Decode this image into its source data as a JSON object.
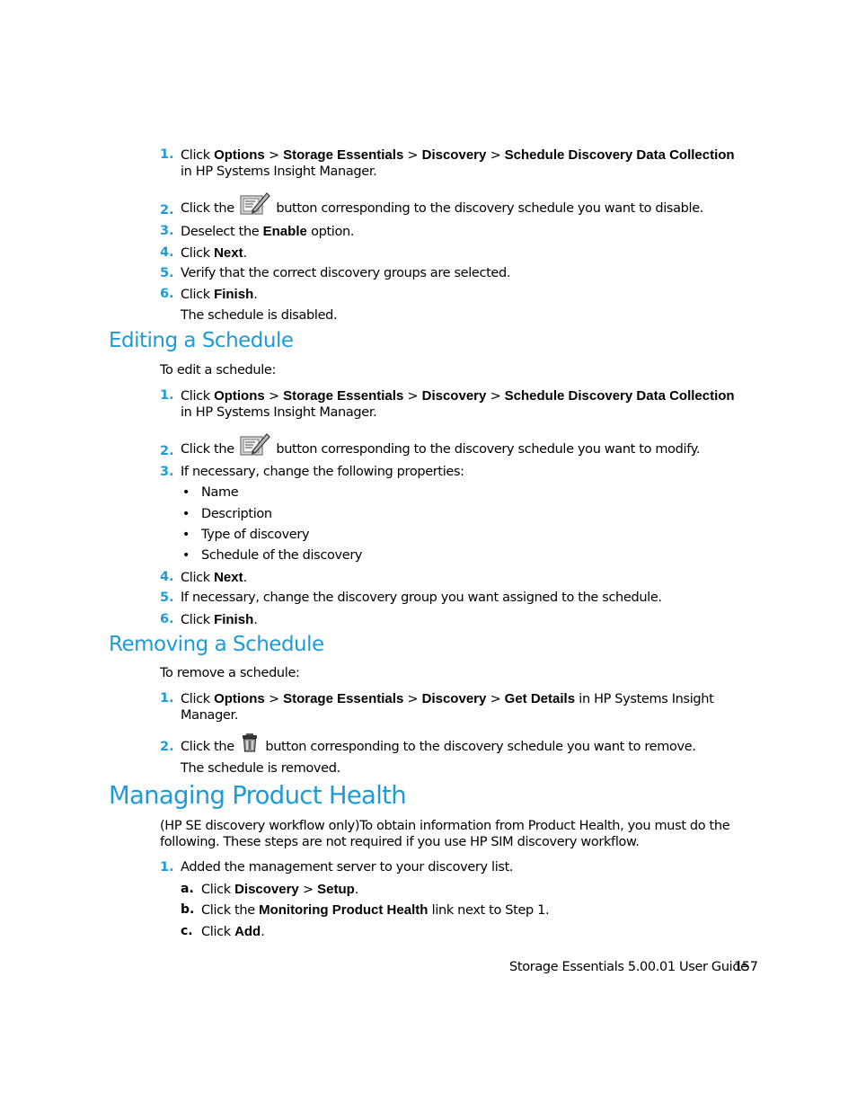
{
  "disable_steps": {
    "step1": {
      "num": "1.",
      "pre": "Click ",
      "b1": "Options",
      "sep1": " > ",
      "b2": "Storage Essentials",
      "sep2": " > ",
      "b3": "Discovery",
      "sep3": " > ",
      "b4": "Schedule Discovery Data Collection",
      "line2": "in HP Systems Insight Manager."
    },
    "step2": {
      "num": "2.",
      "pre": "Click the",
      "icon": "edit-schedule-icon",
      "post": "button corresponding to the discovery schedule you want to disable."
    },
    "step3": {
      "num": "3.",
      "pre": "Deselect the ",
      "b": "Enable",
      "post": " option."
    },
    "step4": {
      "num": "4.",
      "pre": "Click ",
      "b": "Next",
      "post": "."
    },
    "step5": {
      "num": "5.",
      "text": "Verify that the correct discovery groups are selected."
    },
    "step6": {
      "num": "6.",
      "pre": "Click ",
      "b": "Finish",
      "post": "."
    },
    "result": "The schedule is disabled."
  },
  "editing": {
    "heading": "Editing a Schedule",
    "intro": "To edit a schedule:",
    "step1": {
      "num": "1.",
      "pre": "Click ",
      "b1": "Options",
      "sep1": " > ",
      "b2": "Storage Essentials",
      "sep2": " > ",
      "b3": "Discovery",
      "sep3": " > ",
      "b4": "Schedule Discovery Data Collection",
      "line2": "in HP Systems Insight Manager."
    },
    "step2": {
      "num": "2.",
      "pre": "Click the",
      "icon": "edit-schedule-icon",
      "post": "button corresponding to the discovery schedule you want to modify."
    },
    "step3": {
      "num": "3.",
      "text": "If necessary, change the following properties:",
      "bullets": [
        "Name",
        "Description",
        "Type of discovery",
        "Schedule of the discovery"
      ]
    },
    "step4": {
      "num": "4.",
      "pre": "Click ",
      "b": "Next",
      "post": "."
    },
    "step5": {
      "num": "5.",
      "text": "If necessary, change the discovery group you want assigned to the schedule."
    },
    "step6": {
      "num": "6.",
      "pre": "Click ",
      "b": "Finish",
      "post": "."
    }
  },
  "removing": {
    "heading": "Removing a Schedule",
    "intro": "To remove a schedule:",
    "step1": {
      "num": "1.",
      "pre": "Click ",
      "b1": "Options",
      "sep1": " > ",
      "b2": "Storage Essentials",
      "sep2": " > ",
      "b3": "Discovery",
      "sep3": " > ",
      "b4": "Get Details",
      "post": " in HP Systems Insight",
      "line2": "Manager."
    },
    "step2": {
      "num": "2.",
      "pre": "Click the",
      "icon": "delete-schedule-icon",
      "post": "button corresponding to the discovery schedule you want to remove."
    },
    "result": "The schedule is removed."
  },
  "product_health": {
    "heading": "Managing Product Health",
    "intro_line1": "(HP SE discovery workflow only)To obtain information from Product Health, you must do the",
    "intro_line2": "following. These steps are not required if you use HP SIM discovery workflow.",
    "step1": {
      "num": "1.",
      "text": "Added the management server to your discovery list."
    },
    "sub_a": {
      "letter": "a.",
      "pre": "Click ",
      "b1": "Discovery",
      "sep": " > ",
      "b2": "Setup",
      "post": "."
    },
    "sub_b": {
      "letter": "b.",
      "pre": "Click the ",
      "b": "Monitoring Product Health",
      "post": " link next to Step 1."
    },
    "sub_c": {
      "letter": "c.",
      "pre": "Click ",
      "b": "Add",
      "post": "."
    }
  },
  "footer": {
    "guide_title": "Storage Essentials 5.00.01 User Guide",
    "page_number": "157"
  }
}
